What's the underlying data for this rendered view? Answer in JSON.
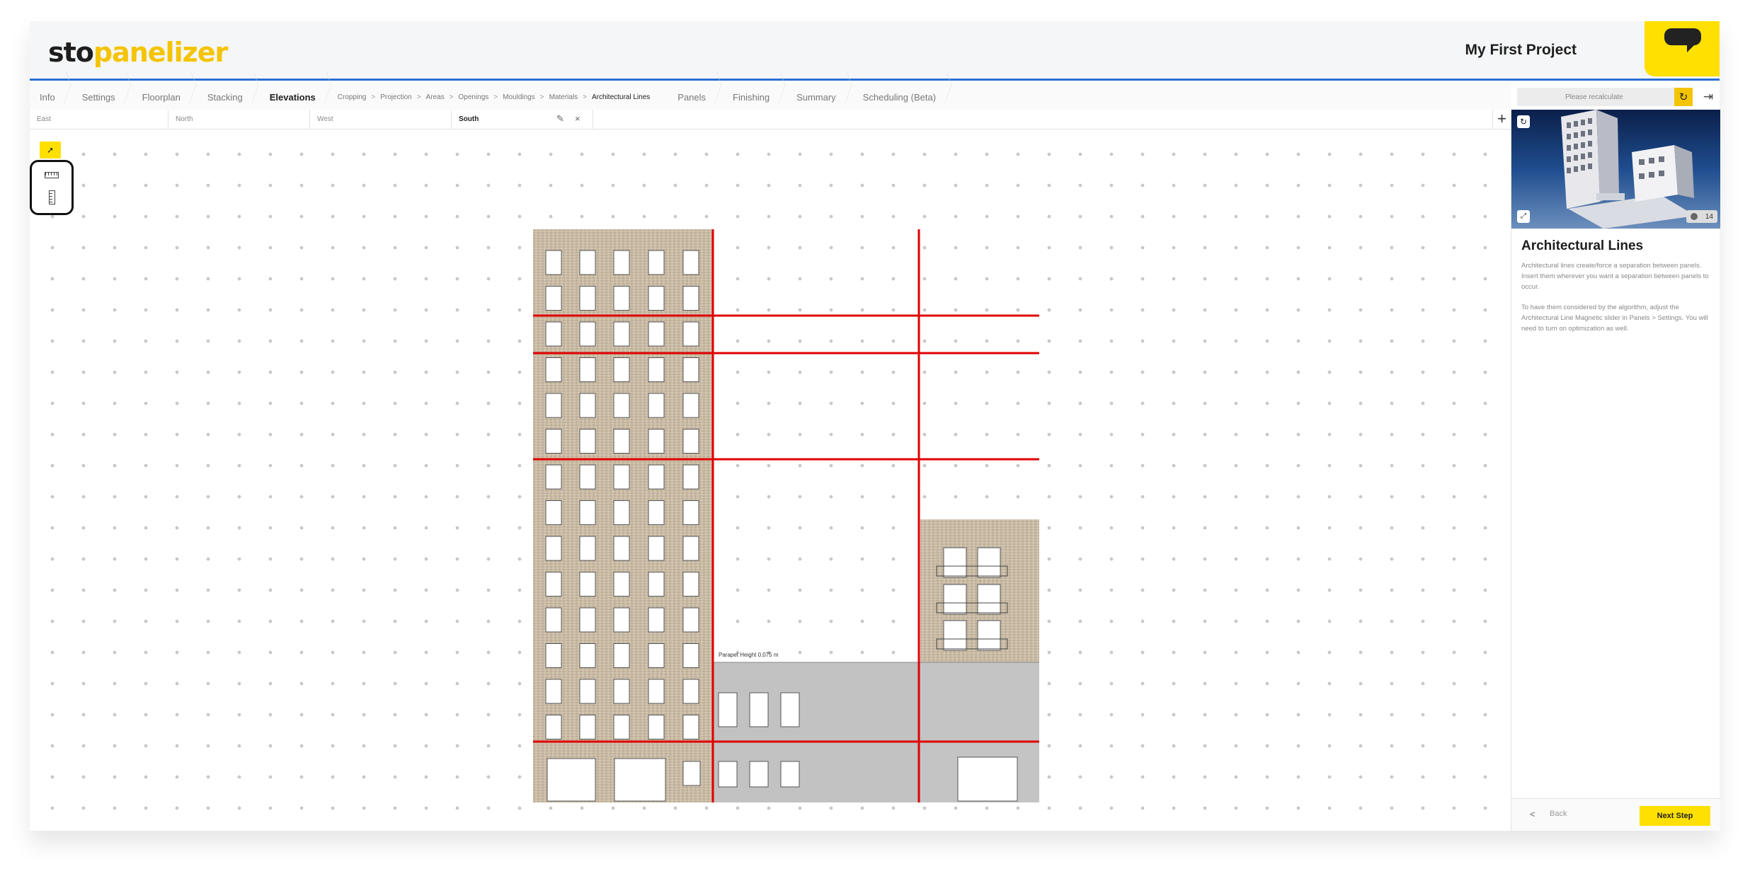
{
  "header": {
    "logo_sto": "sto",
    "logo_panelizer": "panelizer",
    "project_title": "My First Project"
  },
  "nav": {
    "items": [
      {
        "label": "Info"
      },
      {
        "label": "Settings"
      },
      {
        "label": "Floorplan"
      },
      {
        "label": "Stacking"
      },
      {
        "label": "Elevations"
      }
    ],
    "sub_items": [
      {
        "label": "Cropping"
      },
      {
        "label": "Projection"
      },
      {
        "label": "Areas"
      },
      {
        "label": "Openings"
      },
      {
        "label": "Mouldings"
      },
      {
        "label": "Materials"
      },
      {
        "label": "Architectural Lines"
      }
    ],
    "sub_separator": ">",
    "items_after": [
      {
        "label": "Panels"
      },
      {
        "label": "Finishing"
      },
      {
        "label": "Summary"
      },
      {
        "label": "Scheduling (Beta)"
      }
    ]
  },
  "recalc": {
    "label": "Please recalculate",
    "icon": "refresh-icon"
  },
  "elevation_tabs": [
    {
      "label": "East"
    },
    {
      "label": "North"
    },
    {
      "label": "West"
    },
    {
      "label": "South",
      "active": true
    }
  ],
  "add_tab_label": "+",
  "tools": {
    "select_icon": "cursor-icon",
    "horizontal_line_icon": "horizontal-ruler-icon",
    "vertical_line_icon": "vertical-ruler-icon"
  },
  "drawing": {
    "parapet_label": "Parapet Height 0,075 m",
    "line_color": "#e00000"
  },
  "right_panel": {
    "preview_badge": "14",
    "title": "Architectural Lines",
    "paragraph1": "Architectural lines create/force a separation between panels. Insert them wherever you want a separation between panels to occur.",
    "paragraph2": "To have them considered by the algorithm, adjust the Architectural Line Magnetic slider in Panels > Settings. You will need to turn on optimization as well.",
    "back_label": "Back",
    "next_label": "Next Step"
  },
  "colors": {
    "accent": "#ffe000",
    "nav_underline": "#2a6fd6",
    "architectural_line": "#e00000"
  }
}
